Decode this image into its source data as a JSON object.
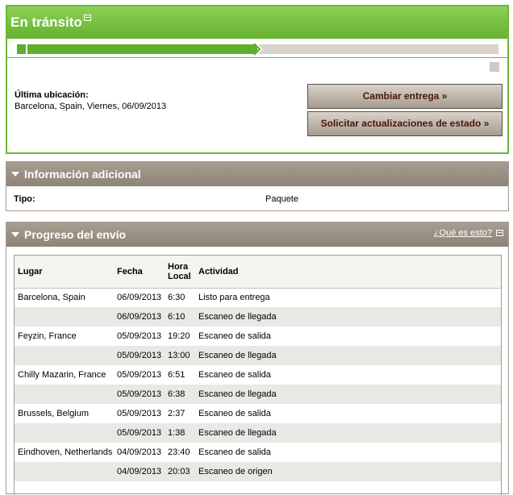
{
  "transit": {
    "title": "En tránsito",
    "progress_fraction": 0.5,
    "last_location_label": "Última ubicación:",
    "last_location_value": "Barcelona, Spain, Viernes, 06/09/2013",
    "change_delivery_label": "Cambiar entrega »",
    "request_updates_label": "Solicitar actualizaciones de estado »"
  },
  "additional_info": {
    "title": "Información adicional",
    "type_label": "Tipo:",
    "type_value": "Paquete"
  },
  "shipment_progress": {
    "title": "Progreso del envío",
    "whats_this_link": "¿Qué es esto?",
    "columns": {
      "location": "Lugar",
      "date": "Fecha",
      "local_time_line1": "Hora",
      "local_time_line2": "Local",
      "activity": "Actividad"
    },
    "rows": [
      {
        "location": "Barcelona, Spain",
        "date": "06/09/2013",
        "time": "6:30",
        "activity": "Listo para entrega"
      },
      {
        "location": "",
        "date": "06/09/2013",
        "time": "6:10",
        "activity": "Escaneo de llegada"
      },
      {
        "location": "Feyzin, France",
        "date": "05/09/2013",
        "time": "19:20",
        "activity": "Escaneo de salida"
      },
      {
        "location": "",
        "date": "05/09/2013",
        "time": "13:00",
        "activity": "Escaneo de llegada"
      },
      {
        "location": "Chilly Mazarin, France",
        "date": "05/09/2013",
        "time": "6:51",
        "activity": "Escaneo de salida"
      },
      {
        "location": "",
        "date": "05/09/2013",
        "time": "6:38",
        "activity": "Escaneo de llegada"
      },
      {
        "location": "Brussels, Belgium",
        "date": "05/09/2013",
        "time": "2:37",
        "activity": "Escaneo de salida"
      },
      {
        "location": "",
        "date": "05/09/2013",
        "time": "1:38",
        "activity": "Escaneo de llegada"
      },
      {
        "location": "Eindhoven, Netherlands",
        "date": "04/09/2013",
        "time": "23:40",
        "activity": "Escaneo de salida"
      },
      {
        "location": "",
        "date": "04/09/2013",
        "time": "20:03",
        "activity": "Escaneo de origen"
      }
    ]
  },
  "colors": {
    "green_accent": "#6cb83a",
    "progress_green": "#5fae2c",
    "brown_header": "#9a8f83",
    "button_text": "#4a1410"
  },
  "icons": [
    "help-box-icon",
    "collapse-triangle-icon",
    "progress-chevron-icon"
  ]
}
